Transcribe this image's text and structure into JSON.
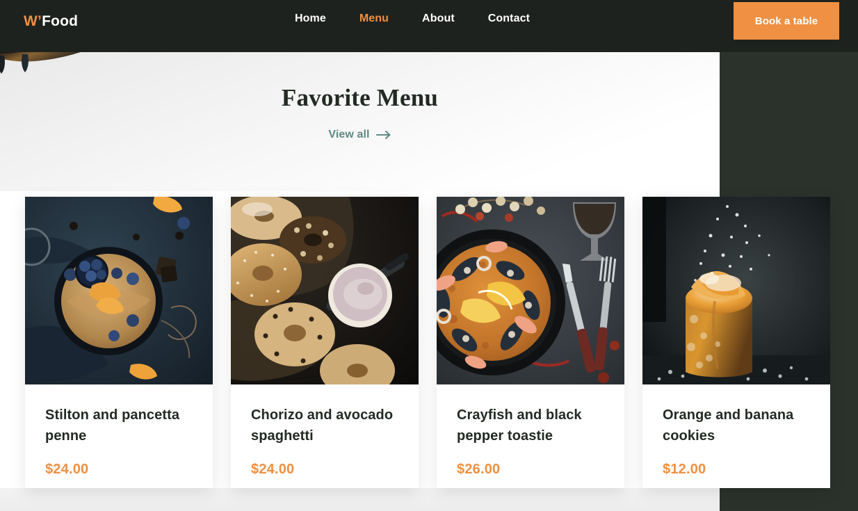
{
  "header": {
    "logo_mark": "W’",
    "logo_text": "Food",
    "nav": [
      {
        "label": "Home",
        "active": false
      },
      {
        "label": "Menu",
        "active": true
      },
      {
        "label": "About",
        "active": false
      },
      {
        "label": "Contact",
        "active": false
      }
    ],
    "cta_label": "Book a table",
    "colors": {
      "bar_background": "#1e221e",
      "accent": "#ef9042",
      "nav_text": "#ffffff"
    }
  },
  "section": {
    "title": "Favorite Menu",
    "view_all_label": "View all",
    "view_all_icon": "arrow-right-icon",
    "view_all_color": "#5f8a82",
    "title_color": "#232a24"
  },
  "menu_items": [
    {
      "name": "Stilton and pancetta penne",
      "price": "$24.00",
      "image_alt": "pancakes-in-skillet-with-blueberries-and-orange"
    },
    {
      "name": "Chorizo and avocado spaghetti",
      "price": "$24.00",
      "image_alt": "assorted-bagels-with-cream-cheese-bowl"
    },
    {
      "name": "Crayfish and black pepper toastie",
      "price": "$26.00",
      "image_alt": "seafood-paella-pan-with-wine-and-cutlery"
    },
    {
      "name": "Orange and banana cookies",
      "price": "$12.00",
      "image_alt": "panettone-dusted-with-powdered-sugar"
    }
  ],
  "theme": {
    "page_background": "#ffffff",
    "panel_green": "#2b322c",
    "price_color": "#ef9042",
    "card_background": "#ffffff"
  },
  "decoration": {
    "top_left_image_alt": "dark-bread-on-wood-board-partial"
  }
}
